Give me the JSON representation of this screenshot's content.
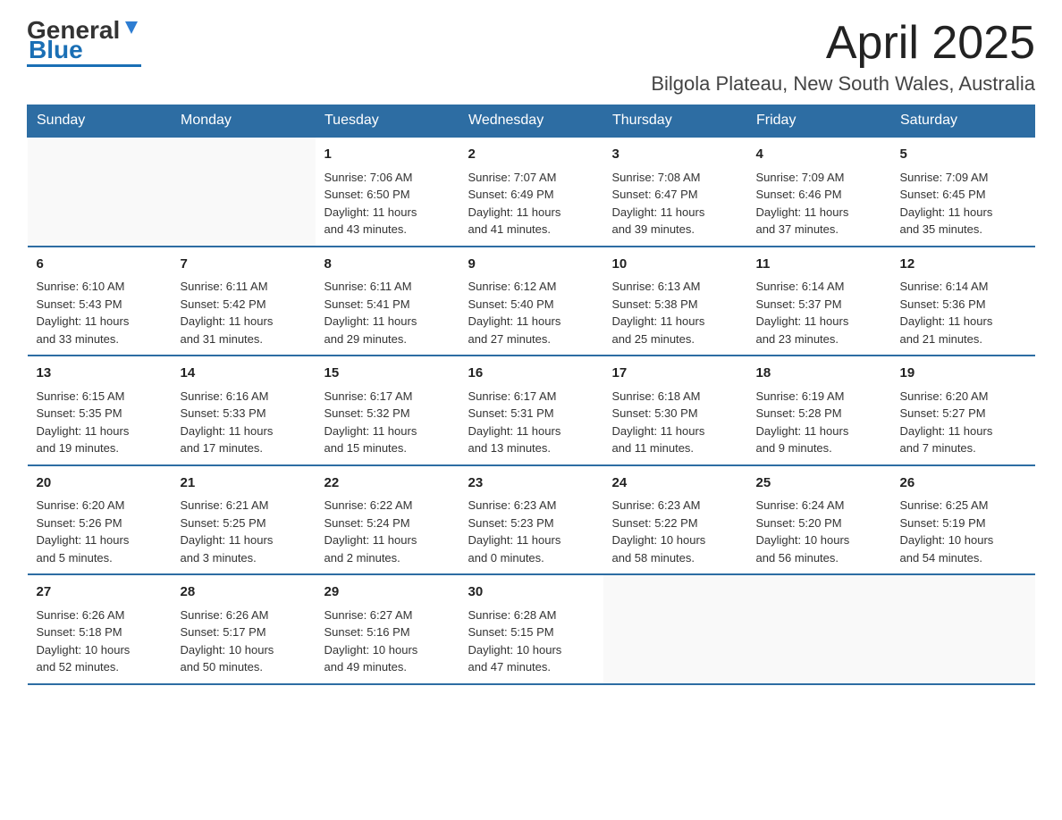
{
  "logo": {
    "general": "General",
    "arrow": "▶",
    "blue": "Blue"
  },
  "header": {
    "month": "April 2025",
    "location": "Bilgola Plateau, New South Wales, Australia"
  },
  "days": {
    "headers": [
      "Sunday",
      "Monday",
      "Tuesday",
      "Wednesday",
      "Thursday",
      "Friday",
      "Saturday"
    ]
  },
  "weeks": [
    {
      "cells": [
        {
          "day": "",
          "info": ""
        },
        {
          "day": "",
          "info": ""
        },
        {
          "day": "1",
          "info": "Sunrise: 7:06 AM\nSunset: 6:50 PM\nDaylight: 11 hours\nand 43 minutes."
        },
        {
          "day": "2",
          "info": "Sunrise: 7:07 AM\nSunset: 6:49 PM\nDaylight: 11 hours\nand 41 minutes."
        },
        {
          "day": "3",
          "info": "Sunrise: 7:08 AM\nSunset: 6:47 PM\nDaylight: 11 hours\nand 39 minutes."
        },
        {
          "day": "4",
          "info": "Sunrise: 7:09 AM\nSunset: 6:46 PM\nDaylight: 11 hours\nand 37 minutes."
        },
        {
          "day": "5",
          "info": "Sunrise: 7:09 AM\nSunset: 6:45 PM\nDaylight: 11 hours\nand 35 minutes."
        }
      ]
    },
    {
      "cells": [
        {
          "day": "6",
          "info": "Sunrise: 6:10 AM\nSunset: 5:43 PM\nDaylight: 11 hours\nand 33 minutes."
        },
        {
          "day": "7",
          "info": "Sunrise: 6:11 AM\nSunset: 5:42 PM\nDaylight: 11 hours\nand 31 minutes."
        },
        {
          "day": "8",
          "info": "Sunrise: 6:11 AM\nSunset: 5:41 PM\nDaylight: 11 hours\nand 29 minutes."
        },
        {
          "day": "9",
          "info": "Sunrise: 6:12 AM\nSunset: 5:40 PM\nDaylight: 11 hours\nand 27 minutes."
        },
        {
          "day": "10",
          "info": "Sunrise: 6:13 AM\nSunset: 5:38 PM\nDaylight: 11 hours\nand 25 minutes."
        },
        {
          "day": "11",
          "info": "Sunrise: 6:14 AM\nSunset: 5:37 PM\nDaylight: 11 hours\nand 23 minutes."
        },
        {
          "day": "12",
          "info": "Sunrise: 6:14 AM\nSunset: 5:36 PM\nDaylight: 11 hours\nand 21 minutes."
        }
      ]
    },
    {
      "cells": [
        {
          "day": "13",
          "info": "Sunrise: 6:15 AM\nSunset: 5:35 PM\nDaylight: 11 hours\nand 19 minutes."
        },
        {
          "day": "14",
          "info": "Sunrise: 6:16 AM\nSunset: 5:33 PM\nDaylight: 11 hours\nand 17 minutes."
        },
        {
          "day": "15",
          "info": "Sunrise: 6:17 AM\nSunset: 5:32 PM\nDaylight: 11 hours\nand 15 minutes."
        },
        {
          "day": "16",
          "info": "Sunrise: 6:17 AM\nSunset: 5:31 PM\nDaylight: 11 hours\nand 13 minutes."
        },
        {
          "day": "17",
          "info": "Sunrise: 6:18 AM\nSunset: 5:30 PM\nDaylight: 11 hours\nand 11 minutes."
        },
        {
          "day": "18",
          "info": "Sunrise: 6:19 AM\nSunset: 5:28 PM\nDaylight: 11 hours\nand 9 minutes."
        },
        {
          "day": "19",
          "info": "Sunrise: 6:20 AM\nSunset: 5:27 PM\nDaylight: 11 hours\nand 7 minutes."
        }
      ]
    },
    {
      "cells": [
        {
          "day": "20",
          "info": "Sunrise: 6:20 AM\nSunset: 5:26 PM\nDaylight: 11 hours\nand 5 minutes."
        },
        {
          "day": "21",
          "info": "Sunrise: 6:21 AM\nSunset: 5:25 PM\nDaylight: 11 hours\nand 3 minutes."
        },
        {
          "day": "22",
          "info": "Sunrise: 6:22 AM\nSunset: 5:24 PM\nDaylight: 11 hours\nand 2 minutes."
        },
        {
          "day": "23",
          "info": "Sunrise: 6:23 AM\nSunset: 5:23 PM\nDaylight: 11 hours\nand 0 minutes."
        },
        {
          "day": "24",
          "info": "Sunrise: 6:23 AM\nSunset: 5:22 PM\nDaylight: 10 hours\nand 58 minutes."
        },
        {
          "day": "25",
          "info": "Sunrise: 6:24 AM\nSunset: 5:20 PM\nDaylight: 10 hours\nand 56 minutes."
        },
        {
          "day": "26",
          "info": "Sunrise: 6:25 AM\nSunset: 5:19 PM\nDaylight: 10 hours\nand 54 minutes."
        }
      ]
    },
    {
      "cells": [
        {
          "day": "27",
          "info": "Sunrise: 6:26 AM\nSunset: 5:18 PM\nDaylight: 10 hours\nand 52 minutes."
        },
        {
          "day": "28",
          "info": "Sunrise: 6:26 AM\nSunset: 5:17 PM\nDaylight: 10 hours\nand 50 minutes."
        },
        {
          "day": "29",
          "info": "Sunrise: 6:27 AM\nSunset: 5:16 PM\nDaylight: 10 hours\nand 49 minutes."
        },
        {
          "day": "30",
          "info": "Sunrise: 6:28 AM\nSunset: 5:15 PM\nDaylight: 10 hours\nand 47 minutes."
        },
        {
          "day": "",
          "info": ""
        },
        {
          "day": "",
          "info": ""
        },
        {
          "day": "",
          "info": ""
        }
      ]
    }
  ]
}
